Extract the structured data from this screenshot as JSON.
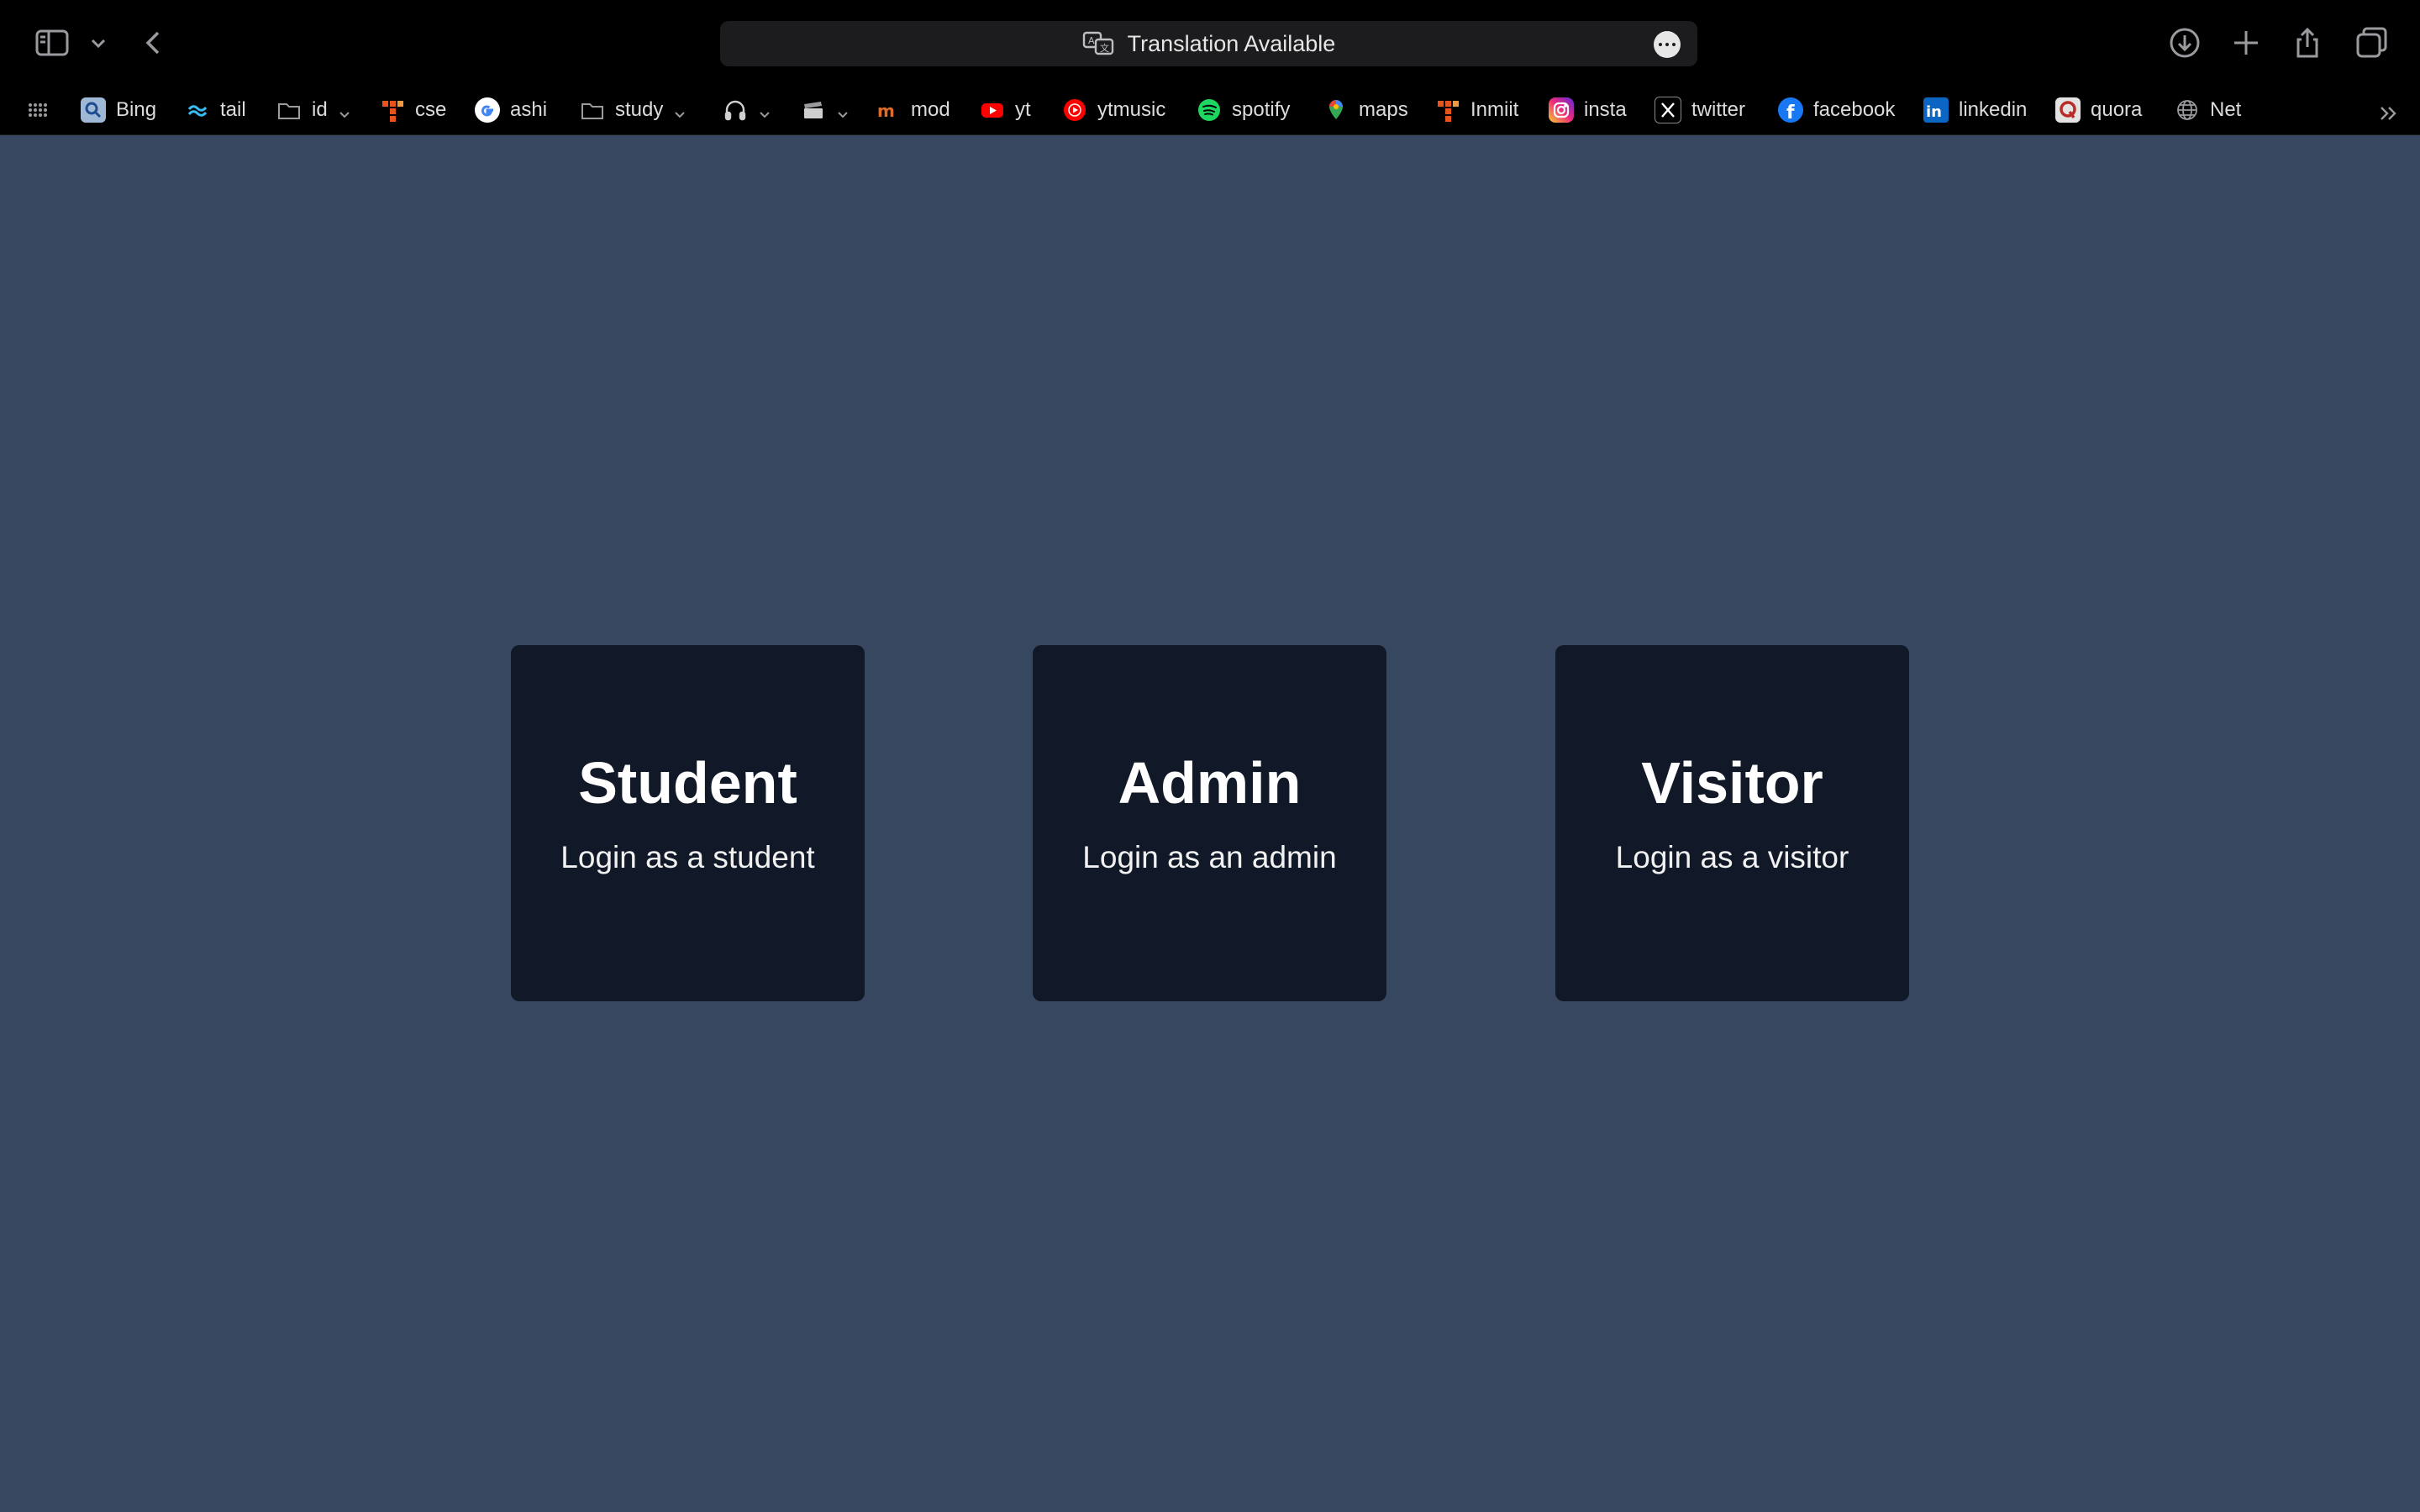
{
  "browser": {
    "address_bar_text": "Translation Available",
    "icons": [
      "sidebar-icon",
      "chevron-down-icon",
      "back-icon",
      "translate-icon",
      "more-icon",
      "download-icon",
      "new-tab-icon",
      "share-icon",
      "tabs-overview-icon"
    ]
  },
  "bookmarks": [
    {
      "label": "Bing",
      "icon": "bing-icon",
      "color": "#9fb8d6"
    },
    {
      "label": "tail",
      "icon": "tailwind-icon",
      "color": "#38bdf8"
    },
    {
      "label": "id",
      "icon": "folder-icon",
      "folder": true
    },
    {
      "label": "cse",
      "icon": "grid-logo-icon",
      "color": "#e8541c"
    },
    {
      "label": "ashi",
      "icon": "google-icon"
    },
    {
      "label": "study",
      "icon": "folder-icon",
      "folder": true
    },
    {
      "label": "",
      "icon": "headphones-icon",
      "folder": true
    },
    {
      "label": "",
      "icon": "clapper-icon",
      "folder": true
    },
    {
      "label": "mod",
      "icon": "mod-icon",
      "color": "#e06c2a"
    },
    {
      "label": "yt",
      "icon": "youtube-icon",
      "color": "#ff0000"
    },
    {
      "label": "ytmusic",
      "icon": "ytmusic-icon",
      "color": "#ff0000"
    },
    {
      "label": "spotify",
      "icon": "spotify-icon",
      "color": "#1ed760"
    },
    {
      "label": "maps",
      "icon": "maps-pin-icon",
      "color": "#34a853"
    },
    {
      "label": "Inmiit",
      "icon": "grid-logo-icon",
      "color": "#e8541c"
    },
    {
      "label": "insta",
      "icon": "instagram-icon",
      "color": "#e1306c"
    },
    {
      "label": "twitter",
      "icon": "x-icon"
    },
    {
      "label": "facebook",
      "icon": "facebook-icon",
      "color": "#1877f2"
    },
    {
      "label": "linkedin",
      "icon": "linkedin-icon",
      "color": "#0a66c2"
    },
    {
      "label": "quora",
      "icon": "quora-icon",
      "color": "#b92b27"
    },
    {
      "label": "Net",
      "icon": "globe-icon"
    }
  ],
  "cards": [
    {
      "title": "Student",
      "subtitle": "Login as a student"
    },
    {
      "title": "Admin",
      "subtitle": "Login as an admin"
    },
    {
      "title": "Visitor",
      "subtitle": "Login as a visitor"
    }
  ],
  "colors": {
    "page_bg": "#374760",
    "card_bg": "#111827",
    "toolbar_bg": "#000000"
  }
}
